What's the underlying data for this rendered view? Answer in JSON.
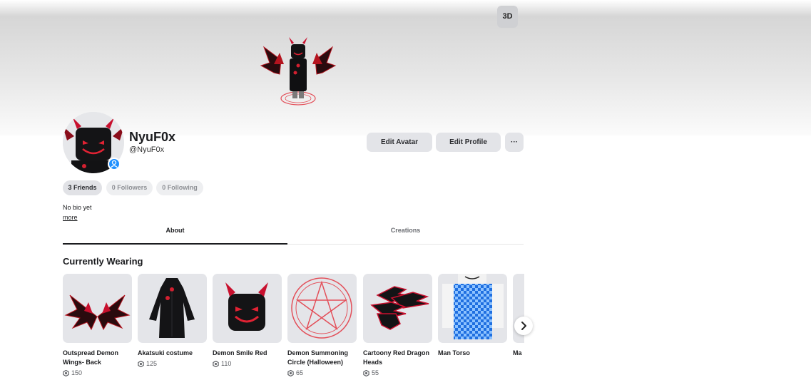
{
  "hero": {
    "view_toggle_label": "3D"
  },
  "profile": {
    "display_name": "NyuF0x",
    "username": "@NyuF0x",
    "edit_avatar_label": "Edit Avatar",
    "edit_profile_label": "Edit Profile",
    "more_options_label": "···"
  },
  "stats": {
    "friends": "3 Friends",
    "followers": "0 Followers",
    "following": "0 Following"
  },
  "bio": {
    "text": "No bio yet",
    "more_label": "more"
  },
  "tabs": [
    {
      "label": "About",
      "active": true
    },
    {
      "label": "Creations",
      "active": false
    }
  ],
  "wearing": {
    "title": "Currently Wearing",
    "items": [
      {
        "name": "Outspread Demon Wings- Back",
        "price": "150",
        "icon": "demon-wings"
      },
      {
        "name": "Akatsuki costume",
        "price": "125",
        "icon": "black-cloak"
      },
      {
        "name": "Demon Smile Red",
        "price": "110",
        "icon": "demon-head"
      },
      {
        "name": "Demon Summoning Circle (Halloween)",
        "price": "65",
        "icon": "pentagram-circle"
      },
      {
        "name": "Cartoony Red Dragon Heads",
        "price": "55",
        "icon": "dragon-heads"
      },
      {
        "name": "Man Torso",
        "price": "",
        "icon": "torso"
      },
      {
        "name": "Ma",
        "price": "",
        "icon": "partial-item"
      }
    ]
  },
  "colors": {
    "accent": "#1e90ff",
    "demon_red": "#c8102e",
    "card_bg": "#e4e5e9"
  }
}
